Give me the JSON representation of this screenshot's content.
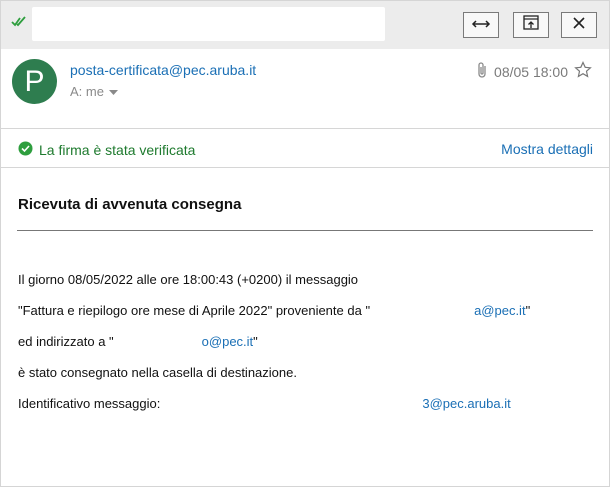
{
  "toolbar": {
    "read_status_icon": "double-check-icon",
    "subject_value": "",
    "buttons": [
      "expand-arrows-icon",
      "open-window-icon",
      "close-icon"
    ]
  },
  "message": {
    "avatar_letter": "P",
    "sender": "posta-certificata@pec.aruba.it",
    "to_label": "A: me",
    "date": "08/05 18:00"
  },
  "signature": {
    "status_text": "La firma è stata verificata",
    "details_link": "Mostra dettagli"
  },
  "content": {
    "title": "Ricevuta di avvenuta consegna",
    "line1": "Il giorno 08/05/2022 alle ore 18:00:43 (+0200) il messaggio",
    "line2_text": "\"Fattura e riepilogo ore mese di Aprile 2022\" proveniente da \"",
    "line2_email": "a@pec.it",
    "line2_end": "\"",
    "line3_text": "ed indirizzato a \"",
    "line3_email": "o@pec.it",
    "line3_end": "\"",
    "line4": "è stato consegnato nella casella di destinazione.",
    "line5_text": "Identificativo messaggio:",
    "line5_email": "3@pec.aruba.it"
  },
  "colors": {
    "accent": "#1a6fb5",
    "success": "#1e7a2e",
    "avatar": "#2e7d4f",
    "topbar": "#ececec"
  }
}
